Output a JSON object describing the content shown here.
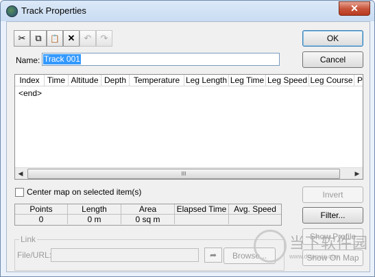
{
  "window": {
    "title": "Track Properties",
    "close_label": "✕"
  },
  "toolbar": {
    "cut_icon": "scissors-icon",
    "copy_icon": "copy-icon",
    "paste_icon": "paste-icon",
    "delete_icon": "delete-icon",
    "undo_icon": "undo-icon",
    "redo_icon": "redo-icon",
    "cut_glyph": "✂",
    "copy_glyph": "⧉",
    "paste_glyph": "📋",
    "delete_glyph": "✕",
    "undo_glyph": "↶",
    "redo_glyph": "↷"
  },
  "buttons": {
    "ok": "OK",
    "cancel": "Cancel",
    "invert": "Invert",
    "filter": "Filter...",
    "show_profile": "Show Profile",
    "show_on_map": "Show On Map",
    "browse": "Browse..."
  },
  "name": {
    "label": "Name:",
    "value": "Track 001"
  },
  "table": {
    "columns": [
      "Index",
      "Time",
      "Altitude",
      "Depth",
      "Temperature",
      "Leg Length",
      "Leg Time",
      "Leg Speed",
      "Leg Course",
      "Pos"
    ],
    "rows": [
      "<end>"
    ],
    "scroll_grip": "III"
  },
  "center_map": {
    "label": "Center map on selected item(s)"
  },
  "stats": {
    "headers": [
      "Points",
      "Length",
      "Area",
      "Elapsed Time",
      "Avg. Speed"
    ],
    "values": [
      "0",
      "0 m",
      "0 sq m",
      "",
      ""
    ]
  },
  "link": {
    "legend": "Link",
    "file_url_label": "File/URL:",
    "file_url_value": "",
    "go_glyph": "➦"
  },
  "watermark": {
    "text": "当下软件园",
    "sub": "www.downxia.com"
  }
}
